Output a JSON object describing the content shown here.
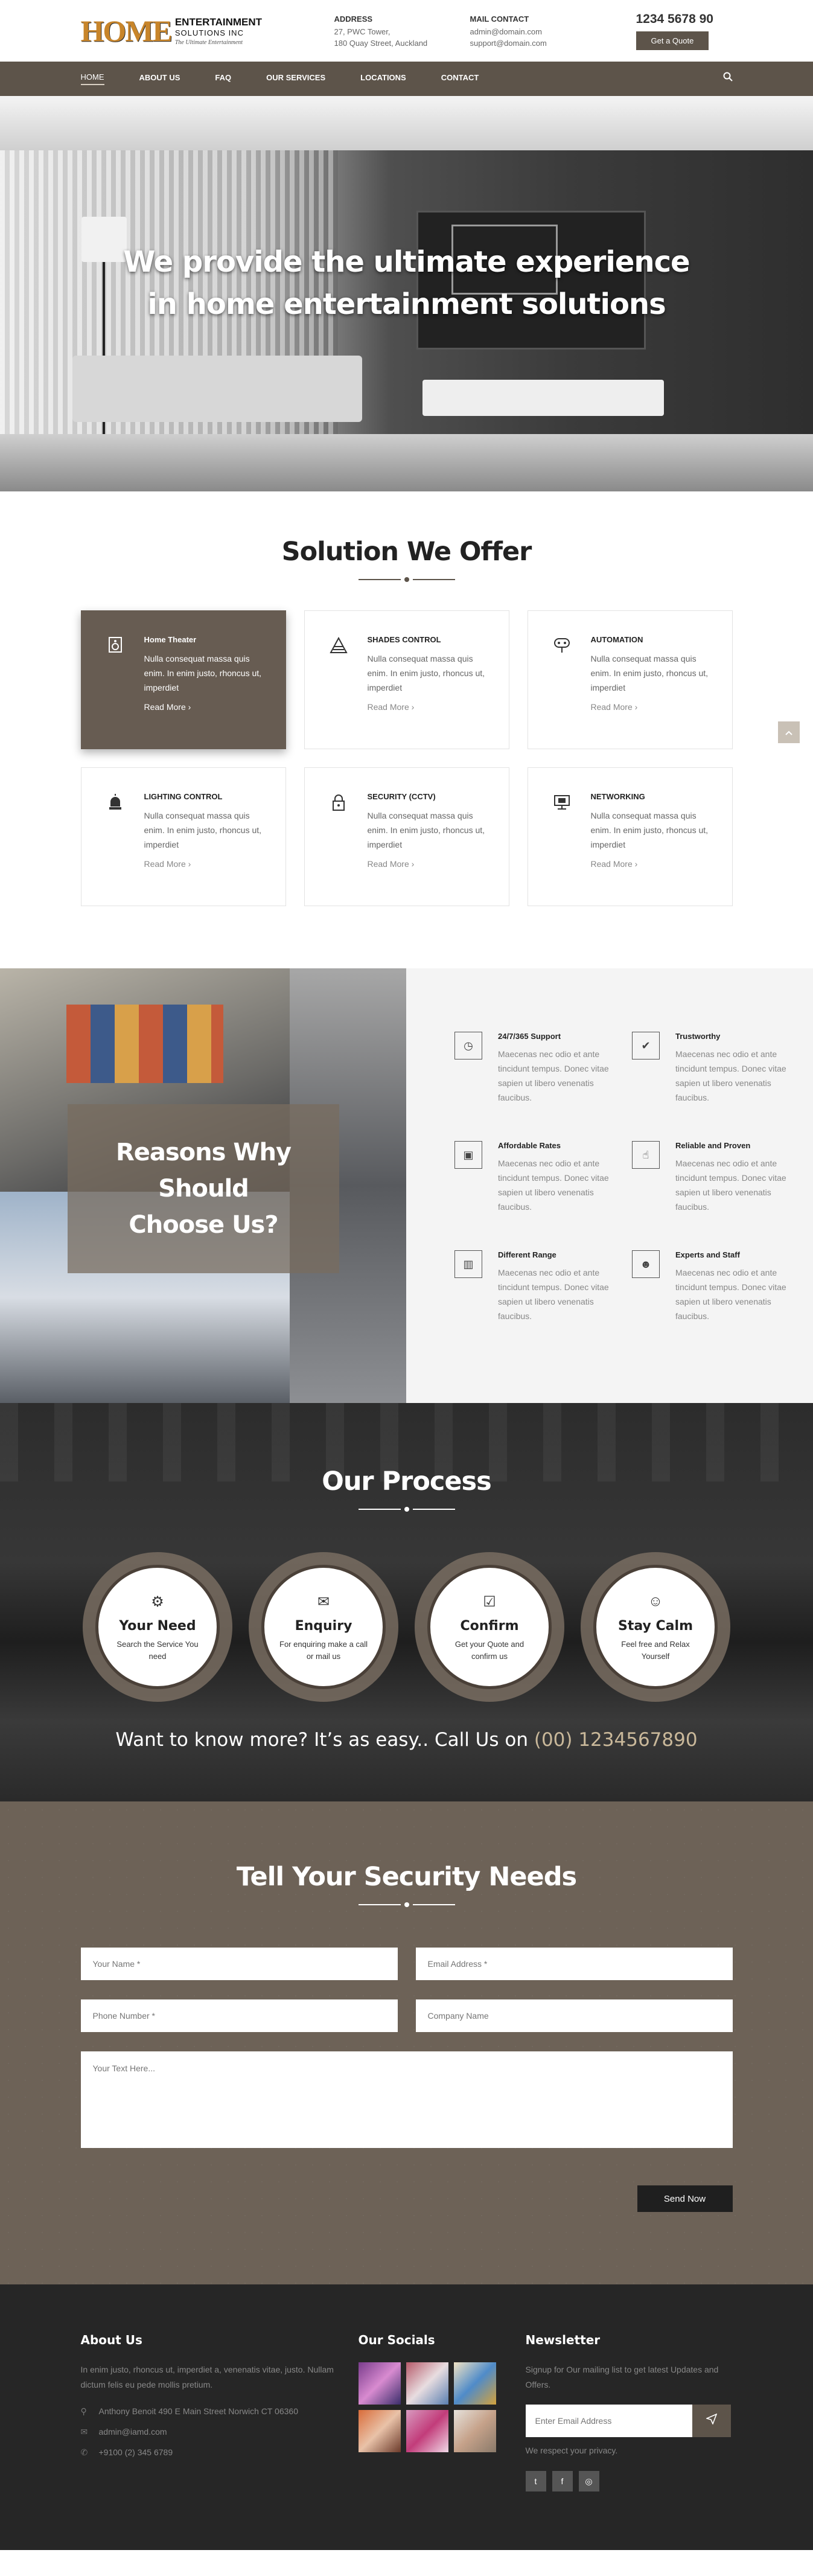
{
  "header": {
    "logo_main": "HOME",
    "logo_line1": "ENTERTAINMENT",
    "logo_line2": "SOLUTIONS INC",
    "logo_tagline": "The Ultimate Entertainment",
    "address_label": "ADDRESS",
    "address_line1": "27, PWC Tower,",
    "address_line2": "180 Quay Street, Auckland",
    "mail_label": "MAIL CONTACT",
    "mail_line1": "admin@domain.com",
    "mail_line2": "support@domain.com",
    "phone": "1234 5678 90",
    "quote_button": "Get a Quote"
  },
  "nav": {
    "items": [
      "HOME",
      "ABOUT US",
      "FAQ",
      "OUR SERVICES",
      "LOCATIONS",
      "CONTACT"
    ],
    "search_icon": "search-icon"
  },
  "hero": {
    "line1": "We provide the ultimate experience",
    "line2": "in home entertainment solutions"
  },
  "solutions": {
    "title": "Solution We Offer",
    "cards": [
      {
        "title": "Home Theater",
        "text": "Nulla consequat massa quis enim. In enim justo, rhoncus ut, imperdiet",
        "more": "Read More",
        "icon": "speaker-icon"
      },
      {
        "title": "SHADES CONTROL",
        "text": "Nulla consequat massa quis enim. In enim justo, rhoncus ut, imperdiet",
        "more": "Read More",
        "icon": "shades-icon"
      },
      {
        "title": "AUTOMATION",
        "text": "Nulla consequat massa quis enim. In enim justo, rhoncus ut, imperdiet",
        "more": "Read More",
        "icon": "automation-icon"
      },
      {
        "title": "LIGHTING CONTROL",
        "text": "Nulla consequat massa quis enim. In enim justo, rhoncus ut, imperdiet",
        "more": "Read More",
        "icon": "lighting-icon"
      },
      {
        "title": "SECURITY (CCTV)",
        "text": "Nulla consequat massa quis enim. In enim justo, rhoncus ut, imperdiet",
        "more": "Read More",
        "icon": "lock-icon"
      },
      {
        "title": "NETWORKING",
        "text": "Nulla consequat massa quis enim. In enim justo, rhoncus ut, imperdiet",
        "more": "Read More",
        "icon": "network-icon"
      }
    ]
  },
  "reasons": {
    "title_line1": "Reasons Why Should",
    "title_line2": "Choose Us?",
    "items": [
      {
        "title": "24/7/365 Support",
        "text": "Maecenas nec odio et ante tincidunt tempus. Donec vitae sapien ut libero venenatis faucibus.",
        "icon": "clock-icon"
      },
      {
        "title": "Trustworthy",
        "text": "Maecenas nec odio et ante tincidunt tempus. Donec vitae sapien ut libero venenatis faucibus.",
        "icon": "check-icon"
      },
      {
        "title": "Affordable Rates",
        "text": "Maecenas nec odio et ante tincidunt tempus. Donec vitae sapien ut libero venenatis faucibus.",
        "icon": "money-icon"
      },
      {
        "title": "Reliable and Proven",
        "text": "Maecenas nec odio et ante tincidunt tempus. Donec vitae sapien ut libero venenatis faucibus.",
        "icon": "thumbs-up-icon"
      },
      {
        "title": "Different Range",
        "text": "Maecenas nec odio et ante tincidunt tempus. Donec vitae sapien ut libero venenatis faucibus.",
        "icon": "bar-chart-icon"
      },
      {
        "title": "Experts and Staff",
        "text": "Maecenas nec odio et ante tincidunt tempus. Donec vitae sapien ut libero venenatis faucibus.",
        "icon": "users-icon"
      }
    ]
  },
  "process": {
    "title": "Our Process",
    "steps": [
      {
        "title": "Your Need",
        "text": "Search the Service You need",
        "icon": "gears-icon"
      },
      {
        "title": "Enquiry",
        "text": "For enquiring make a call or mail us",
        "icon": "inbox-icon"
      },
      {
        "title": "Confirm",
        "text": "Get your Quote and confirm us",
        "icon": "checkbox-icon"
      },
      {
        "title": "Stay Calm",
        "text": "Feel free and Relax Yourself",
        "icon": "smile-icon"
      }
    ],
    "call_text": "Want to know more? It’s as easy.. Call Us on",
    "call_number": "(00) 1234567890"
  },
  "form": {
    "title": "Tell Your Security Needs",
    "name_placeholder": "Your Name *",
    "email_placeholder": "Email Address *",
    "phone_placeholder": "Phone Number *",
    "company_placeholder": "Company Name",
    "message_placeholder": "Your Text Here...",
    "send_button": "Send Now"
  },
  "footer": {
    "about_title": "About Us",
    "about_text": "In enim justo, rhoncus ut, imperdiet a, venenatis vitae, justo. Nullam dictum felis eu pede mollis pretium.",
    "address": "Anthony Benoit 490 E Main Street Norwich CT 06360",
    "email": "admin@iamd.com",
    "phone": "+9100 (2) 345 6789",
    "socials_title": "Our Socials",
    "newsletter_title": "Newsletter",
    "newsletter_text": "Signup for Our mailing list to get latest Updates and Offers.",
    "email_placeholder": "Enter Email Address",
    "privacy_text": "We respect your privacy.",
    "social_icons": [
      "twitter-icon",
      "facebook-icon",
      "instagram-icon"
    ]
  },
  "colors": {
    "brand": "#5d544a",
    "card_active": "#675c52",
    "footer_bg": "#262626"
  }
}
